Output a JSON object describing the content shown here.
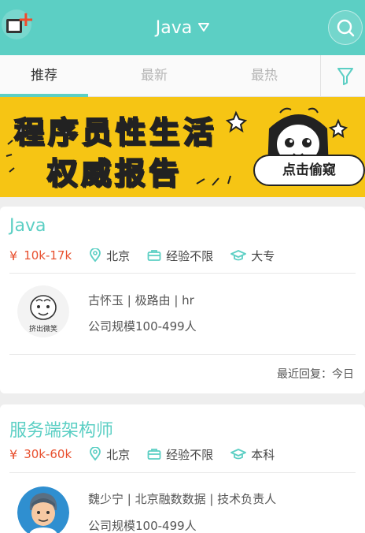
{
  "header": {
    "title": "Java"
  },
  "tabs": [
    "推荐",
    "最新",
    "最热"
  ],
  "banner": {
    "line1": "程序员性生活",
    "line2": "权威报告",
    "button": "点击偷窥"
  },
  "jobs": [
    {
      "title": "Java",
      "salary": "10k-17k",
      "city": "北京",
      "experience": "经验不限",
      "education": "大专",
      "hr": "古怀玉 | 极路由 | hr",
      "company_size": "公司规模100-499人",
      "avatar_caption": "挤出微笑",
      "reply": "最近回复：今日"
    },
    {
      "title": "服务端架构师",
      "salary": "30k-60k",
      "city": "北京",
      "experience": "经验不限",
      "education": "本科",
      "hr": "魏少宁 | 北京融数数据 | 技术负责人",
      "company_size": "公司规模100-499人"
    }
  ],
  "icons": {
    "add": "add-window-icon",
    "caret": "caret-down-icon",
    "search": "search-icon",
    "filter": "filter-icon",
    "currency": "yen-icon",
    "location": "location-pin-icon",
    "experience": "briefcase-icon",
    "education": "graduation-cap-icon"
  },
  "colors": {
    "primary": "#5ccfc4",
    "salary": "#e8502f",
    "banner": "#f6c514"
  }
}
